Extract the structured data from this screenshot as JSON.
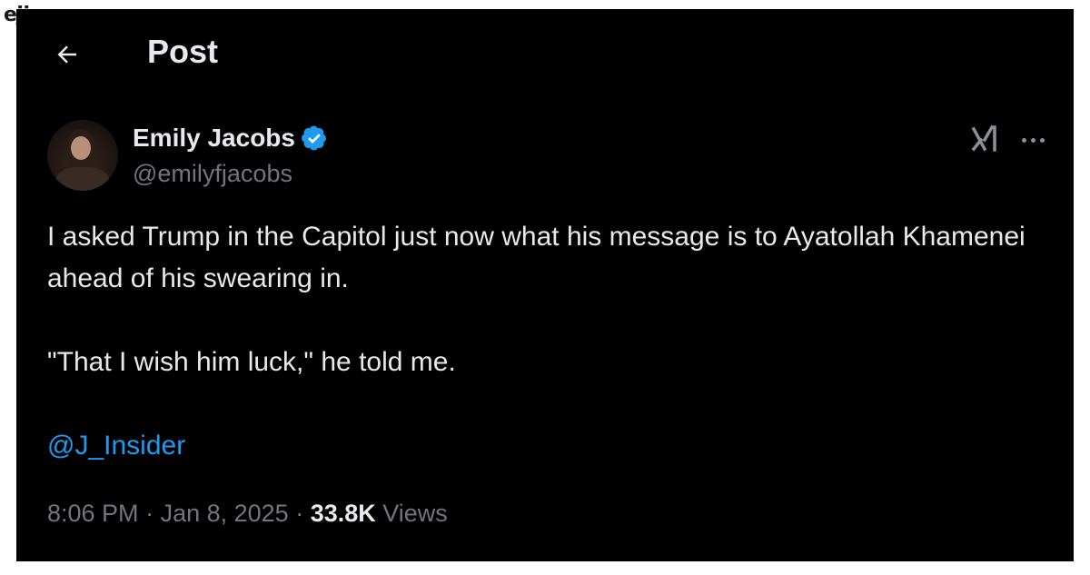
{
  "watermark": "ejiga.com",
  "header": {
    "title": "Post"
  },
  "post": {
    "author_name": "Emily Jacobs",
    "author_handle": "@emilyfjacobs",
    "text_paragraph_1": "I asked Trump in the Capitol just now what his message is to Ayatollah Khamenei ahead of his swearing in.",
    "text_paragraph_2": "\"That I wish him luck,\" he told me.",
    "mention": "@J_Insider",
    "time": "8:06 PM",
    "separator_1": " · ",
    "date": "Jan 8, 2025",
    "separator_2": " · ",
    "views_count": "33.8K",
    "views_label": " Views"
  },
  "icons": {
    "back": "back-arrow-icon",
    "verified": "verified-badge-icon",
    "grok": "grok-icon",
    "more": "more-icon"
  },
  "colors": {
    "background": "#000000",
    "text": "#e7e9ea",
    "secondary": "#71767b",
    "accent": "#1d9bf0"
  }
}
